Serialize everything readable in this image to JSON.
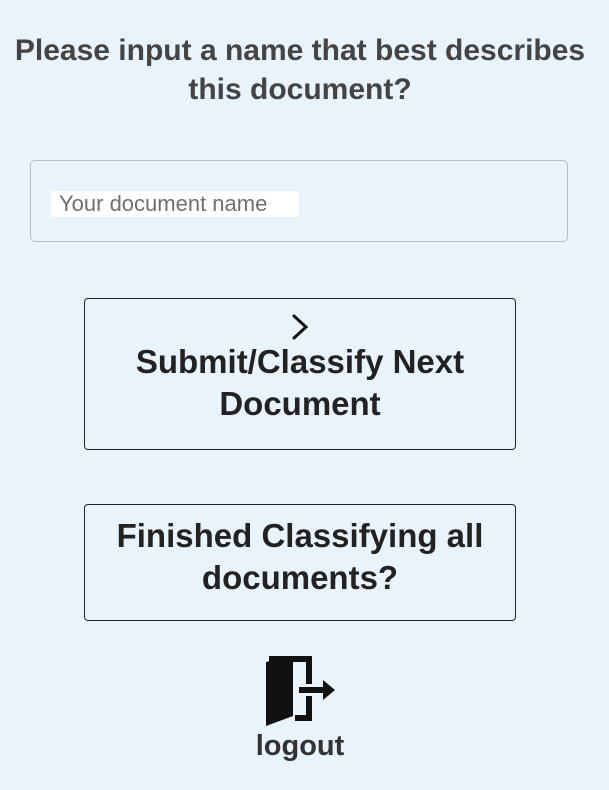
{
  "prompt": {
    "question": "Please input a name that best describes this document?"
  },
  "name_input": {
    "placeholder": "Your document name",
    "value": ""
  },
  "buttons": {
    "submit_label": "Submit/Classify Next Document",
    "submit_icon": "chevron-right-icon",
    "finished_label": "Finished Classifying all documents?"
  },
  "logout": {
    "label": "logout",
    "icon": "door-exit-icon"
  }
}
